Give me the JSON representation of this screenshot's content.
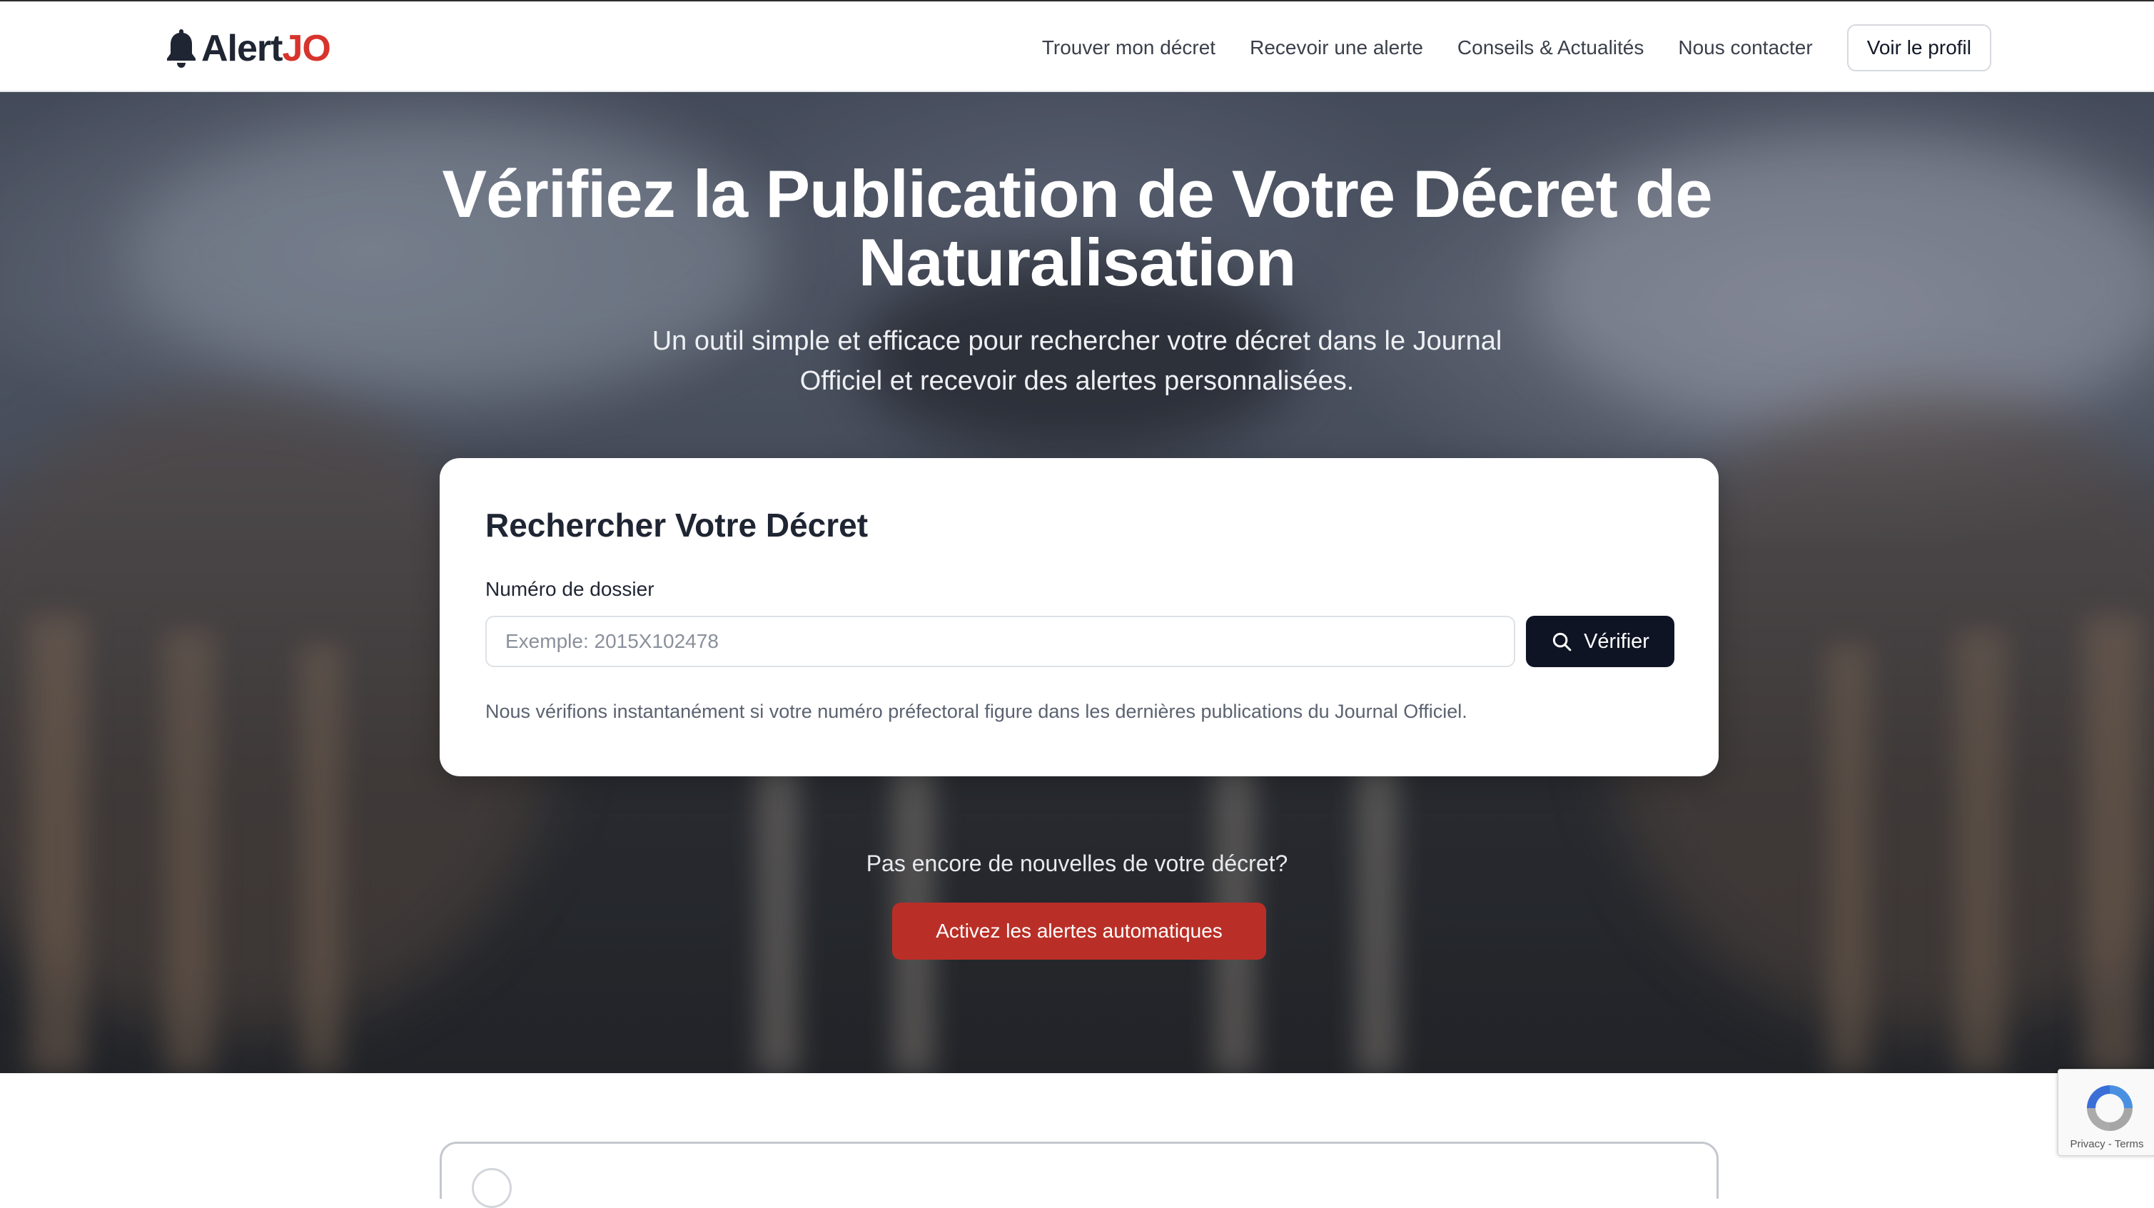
{
  "header": {
    "logo": {
      "part1": "Alert",
      "part2": "JO"
    },
    "nav": [
      {
        "label": "Trouver mon décret"
      },
      {
        "label": "Recevoir une alerte"
      },
      {
        "label": "Conseils & Actualités"
      },
      {
        "label": "Nous contacter"
      }
    ],
    "profile_button": "Voir le profil"
  },
  "hero": {
    "title_line1": "Vérifiez la Publication de Votre Décret de",
    "title_line2": "Naturalisation",
    "subtitle_line1": "Un outil simple et efficace pour rechercher votre décret dans le Journal",
    "subtitle_line2": "Officiel et recevoir des alertes personnalisées."
  },
  "search_card": {
    "title": "Rechercher Votre Décret",
    "field_label": "Numéro de dossier",
    "input_value": "",
    "input_placeholder": "Exemple: 2015X102478",
    "button_label": "Vérifier",
    "note": "Nous vérifions instantanément si votre numéro préfectoral figure dans les dernières publications du Journal Officiel."
  },
  "cta": {
    "question": "Pas encore de nouvelles de votre décret?",
    "button_label": "Activez les alertes automatiques"
  },
  "recaptcha": {
    "privacy": "Privacy",
    "separator": " - ",
    "terms": "Terms"
  },
  "colors": {
    "brand_dark": "#1f2533",
    "brand_red": "#d7342d",
    "primary_button": "#0e1424",
    "alert_button": "#b92f27"
  },
  "icons": {
    "logo": "bell-icon",
    "verify_button": "search-icon",
    "recaptcha": "recaptcha-logo"
  }
}
